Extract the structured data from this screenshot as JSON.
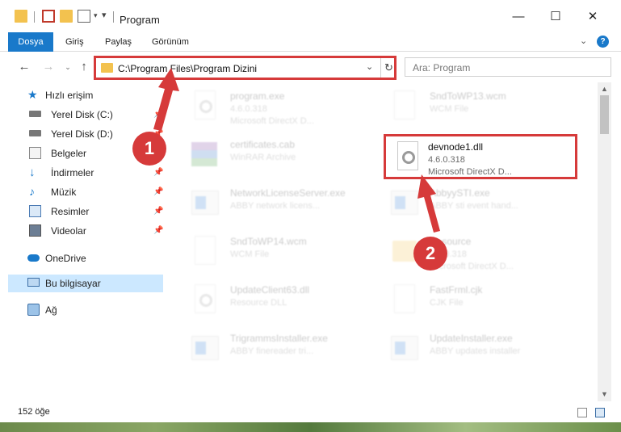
{
  "window": {
    "title": "Program",
    "minimize_icon": "minimize-icon",
    "maximize_icon": "maximize-icon",
    "close_icon": "close-icon"
  },
  "ribbon": {
    "tabs": [
      {
        "label": "Dosya"
      },
      {
        "label": "Giriş"
      },
      {
        "label": "Paylaş"
      },
      {
        "label": "Görünüm"
      }
    ]
  },
  "address": {
    "path": "C:\\Program Files\\Program Dizini"
  },
  "search": {
    "placeholder": "Ara: Program"
  },
  "sidebar": {
    "items": [
      {
        "label": "Hızlı erişim",
        "icon": "star-icon"
      },
      {
        "label": "Yerel Disk (C:)",
        "icon": "drive-icon"
      },
      {
        "label": "Yerel Disk (D:)",
        "icon": "drive-icon"
      },
      {
        "label": "Belgeler",
        "icon": "documents-icon"
      },
      {
        "label": "İndirmeler",
        "icon": "download-icon"
      },
      {
        "label": "Müzik",
        "icon": "music-icon"
      },
      {
        "label": "Resimler",
        "icon": "pictures-icon"
      },
      {
        "label": "Videolar",
        "icon": "video-icon"
      },
      {
        "label": "OneDrive",
        "icon": "cloud-icon"
      },
      {
        "label": "Bu bilgisayar",
        "icon": "computer-icon"
      },
      {
        "label": "Ağ",
        "icon": "network-icon"
      }
    ]
  },
  "files": [
    {
      "name": "program.exe",
      "line2": "4.6.0.318",
      "line3": "Microsoft DirectX D..."
    },
    {
      "name": "SndToWP13.wcm",
      "line2": "WCM File",
      "line3": ""
    },
    {
      "name": "certificates.cab",
      "line2": "WinRAR Archive",
      "line3": ""
    },
    {
      "name": "devnode1.dll",
      "line2": "4.6.0.318",
      "line3": "Microsoft DirectX D..."
    },
    {
      "name": "NetworkLicenseServer.exe",
      "line2": "ABBY network licens...",
      "line3": ""
    },
    {
      "name": "AbbyySTI.exe",
      "line2": "ABBY sti event hand...",
      "line3": ""
    },
    {
      "name": "SndToWP14.wcm",
      "line2": "WCM File",
      "line3": ""
    },
    {
      "name": "Resource",
      "line2": "4.6.0.318",
      "line3": "Microsoft DirectX D..."
    },
    {
      "name": "UpdateClient63.dll",
      "line2": "Resource DLL",
      "line3": ""
    },
    {
      "name": "FastFrml.cjk",
      "line2": "CJK File",
      "line3": ""
    },
    {
      "name": "TrigrammsInstaller.exe",
      "line2": "ABBY finereader tri...",
      "line3": ""
    },
    {
      "name": "UpdateInstaller.exe",
      "line2": "ABBY updates installer",
      "line3": ""
    }
  ],
  "callouts": {
    "first": "1",
    "second": "2"
  },
  "status": {
    "count": "152 öğe"
  },
  "colors": {
    "accent": "#1979ca",
    "callout": "#d63a3a",
    "selection": "#cce8ff"
  }
}
